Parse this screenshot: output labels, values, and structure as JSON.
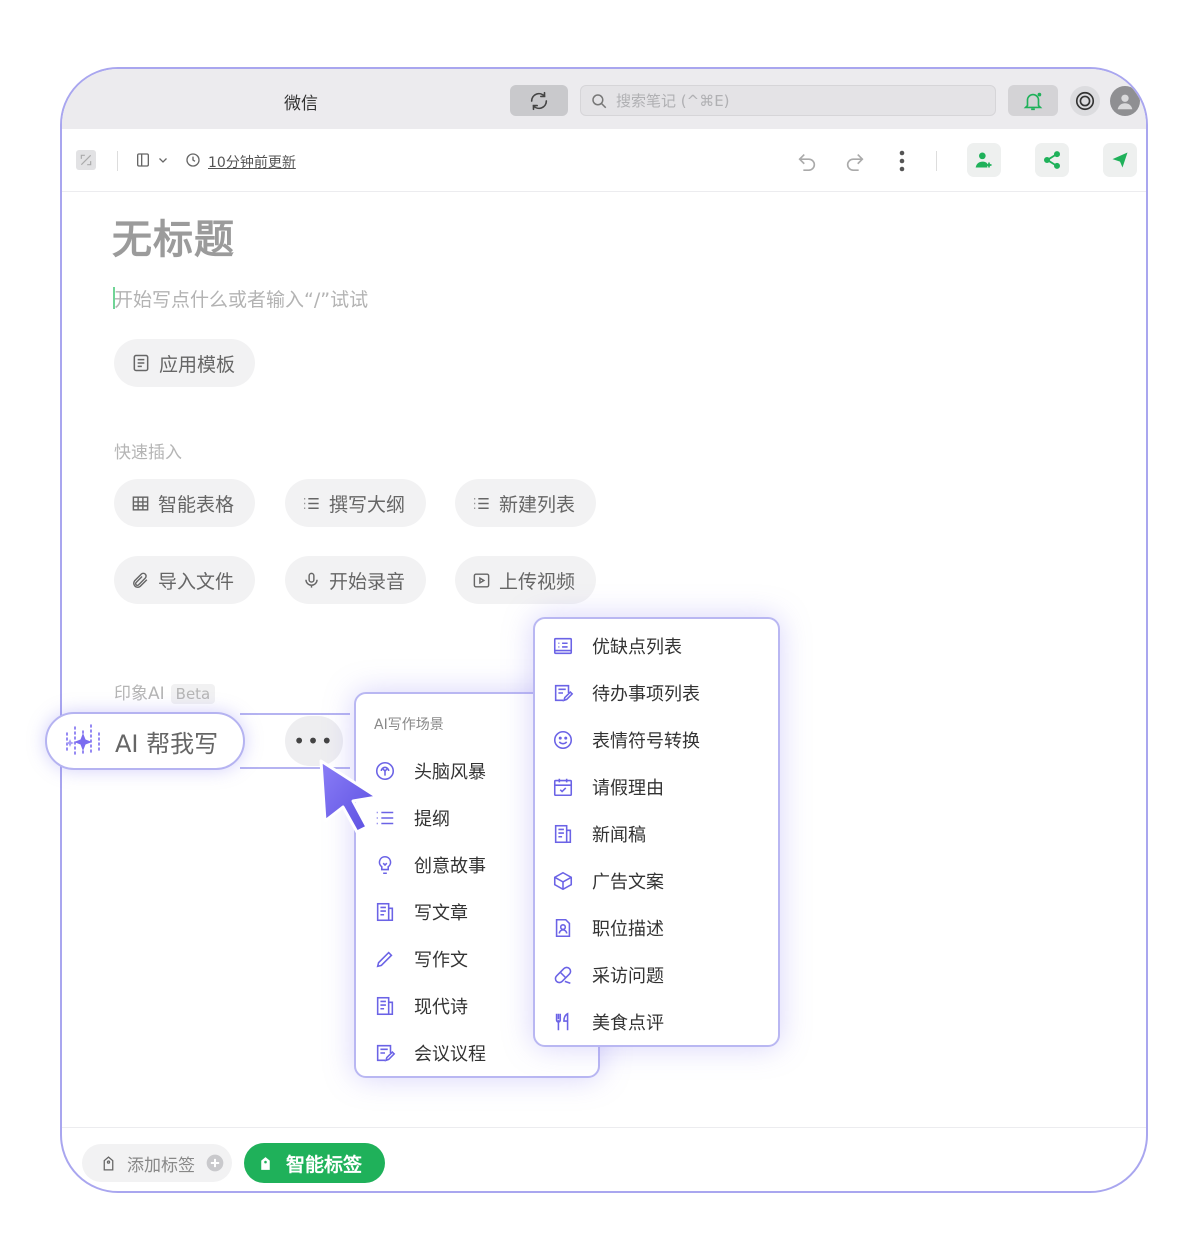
{
  "titlebar": {
    "app_title": "微信",
    "search_placeholder": "搜索笔记 (^⌘E)"
  },
  "toolbar": {
    "updated_text": "10分钟前更新"
  },
  "document": {
    "title": "无标题",
    "placeholder": "开始写点什么或者输入“/”试试",
    "template_button": "应用模板"
  },
  "quick_insert": {
    "label": "快速插入",
    "items": [
      "智能表格",
      "撰写大纲",
      "新建列表",
      "导入文件",
      "开始录音",
      "上传视频"
    ]
  },
  "ai_section": {
    "label": "印象AI",
    "badge": "Beta",
    "button_label": "AI 帮我写",
    "more_label": "•••"
  },
  "scene_menu": {
    "heading": "AI写作场景",
    "items": [
      "头脑风暴",
      "提纲",
      "创意故事",
      "写文章",
      "写作文",
      "现代诗",
      "会议议程"
    ]
  },
  "sub_menu": {
    "items": [
      "优缺点列表",
      "待办事项列表",
      "表情符号转换",
      "请假理由",
      "新闻稿",
      "广告文案",
      "职位描述",
      "采访问题",
      "美食点评"
    ]
  },
  "footer": {
    "add_tag": "添加标签",
    "smart_tag": "智能标签"
  },
  "colors": {
    "accent_purple": "#6b63e6",
    "green": "#1fb15a",
    "window_border": "#a9a6ef"
  }
}
